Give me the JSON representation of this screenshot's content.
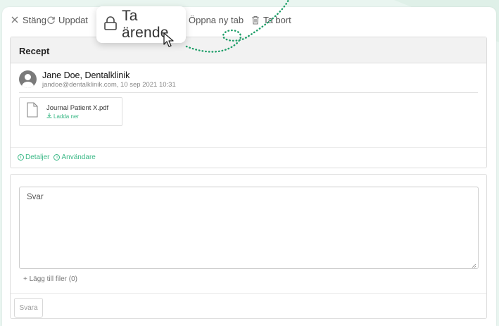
{
  "toolbar": {
    "close_label": "Stäng",
    "refresh_label": "Uppdat",
    "open_tab_label": "Öppna ny tab",
    "delete_label": "Ta bort"
  },
  "popout": {
    "take_case_label": "Ta ärende"
  },
  "message_card": {
    "title": "Recept",
    "sender_name": "Jane Doe, Dentalklinik",
    "sender_meta": "jandoe@dentalklinik.com, 10 sep 2021 10:31",
    "attachment": {
      "filename": "Journal Patient X.pdf",
      "download_label": "Ladda ner"
    },
    "links": {
      "details": "Detaljer",
      "users": "Användare"
    }
  },
  "reply": {
    "placeholder": "Svar",
    "add_files_label": "+ Lägg till filer (0)",
    "submit_label": "Svara"
  },
  "colors": {
    "accent": "#3ab886",
    "background": "#e7f4ef",
    "dotted_line": "#1e9e68"
  },
  "icons": [
    "close-icon",
    "refresh-icon",
    "lock-icon",
    "cursor-icon",
    "external-link-icon",
    "trash-icon",
    "avatar-icon",
    "file-icon",
    "download-icon",
    "info-icon",
    "resize-handle-icon"
  ]
}
